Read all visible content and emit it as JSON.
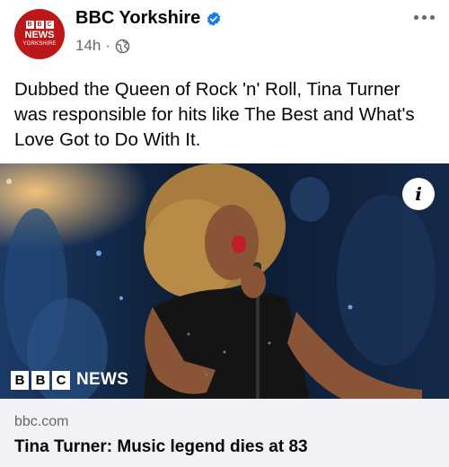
{
  "post": {
    "page_name": "BBC Yorkshire",
    "time": "14h",
    "separator": "·",
    "text": "Dubbed the Queen of Rock 'n' Roll, Tina Turner was responsible for hits like The Best and What's Love Got to Do With It."
  },
  "avatar": {
    "blocks": [
      "B",
      "B",
      "C"
    ],
    "news": "NEWS",
    "region": "YORKSHIRE"
  },
  "photo": {
    "watermark_blocks": [
      "B",
      "B",
      "C"
    ],
    "watermark_news": "NEWS",
    "info_symbol": "i"
  },
  "link": {
    "domain": "bbc.com",
    "headline": "Tina Turner: Music legend dies at 83"
  },
  "icons": {
    "verified": "verified-badge-icon",
    "globe": "globe-icon",
    "more": "more-options-icon",
    "info": "info-icon"
  },
  "colors": {
    "bbc_red": "#bb1919",
    "verified_blue": "#1877f2",
    "secondary_text": "#65676b",
    "card_bg": "#f0f2f5"
  }
}
